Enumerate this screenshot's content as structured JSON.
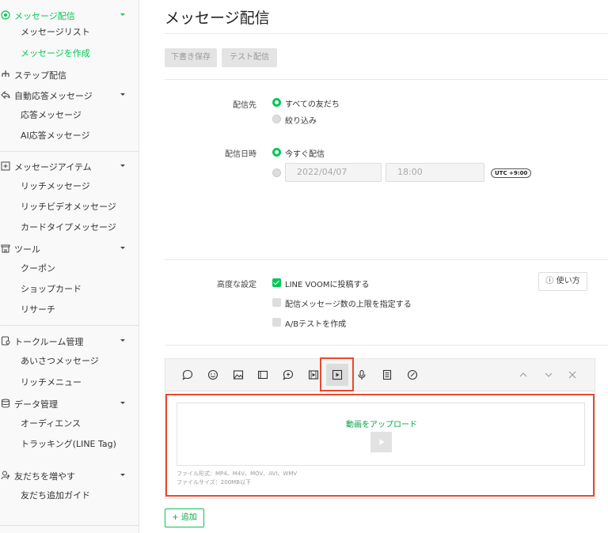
{
  "sidebar": {
    "groups": [
      {
        "label": "メッセージ配信",
        "icon": "broadcast-icon"
      },
      {
        "label": "ステップ配信",
        "icon": "step-icon"
      },
      {
        "label": "自動応答メッセージ",
        "icon": "auto-reply-icon"
      },
      {
        "label": "メッセージアイテム",
        "icon": "message-item-icon"
      },
      {
        "label": "ツール",
        "icon": "tool-icon"
      },
      {
        "label": "トークルーム管理",
        "icon": "chatroom-icon"
      },
      {
        "label": "データ管理",
        "icon": "database-icon"
      },
      {
        "label": "友だちを増やす",
        "icon": "add-friend-icon"
      }
    ],
    "subs": {
      "message_list": "メッセージリスト",
      "create_message": "メッセージを作成",
      "reply_message": "応答メッセージ",
      "ai_reply": "AI応答メッセージ",
      "rich_message": "リッチメッセージ",
      "rich_video": "リッチビデオメッセージ",
      "card_type": "カードタイプメッセージ",
      "coupon": "クーポン",
      "shop_card": "ショップカード",
      "research": "リサーチ",
      "greeting": "あいさつメッセージ",
      "rich_menu": "リッチメニュー",
      "audience": "オーディエンス",
      "tracking": "トラッキング(LINE Tag)",
      "friend_guide": "友だち追加ガイド"
    }
  },
  "main": {
    "title": "メッセージ配信",
    "draft_save": "下書き保存",
    "test_send": "テスト配信",
    "recipient": {
      "label": "配信先",
      "options": [
        "すべての友だち",
        "絞り込み"
      ]
    },
    "schedule": {
      "label": "配信日時",
      "now": "今すぐ配信",
      "date": "2022/04/07",
      "time": "18:00",
      "tz": "UTC +9:00"
    },
    "advanced": {
      "label": "高度な設定",
      "options": [
        "LINE VOOMに投稿する",
        "配信メッセージ数の上限を指定する",
        "A/Bテストを作成"
      ],
      "help": "ⓘ 使い方"
    },
    "editor": {
      "upload_label": "動画をアップロード",
      "file_format": "ファイル形式：MP4、M4V、MOV、AVI、WMV",
      "file_size": "ファイルサイズ：200MB以下"
    },
    "add_button": "+ 追加"
  },
  "colors": {
    "accent": "#06c755",
    "highlight": "#e84a2c"
  }
}
